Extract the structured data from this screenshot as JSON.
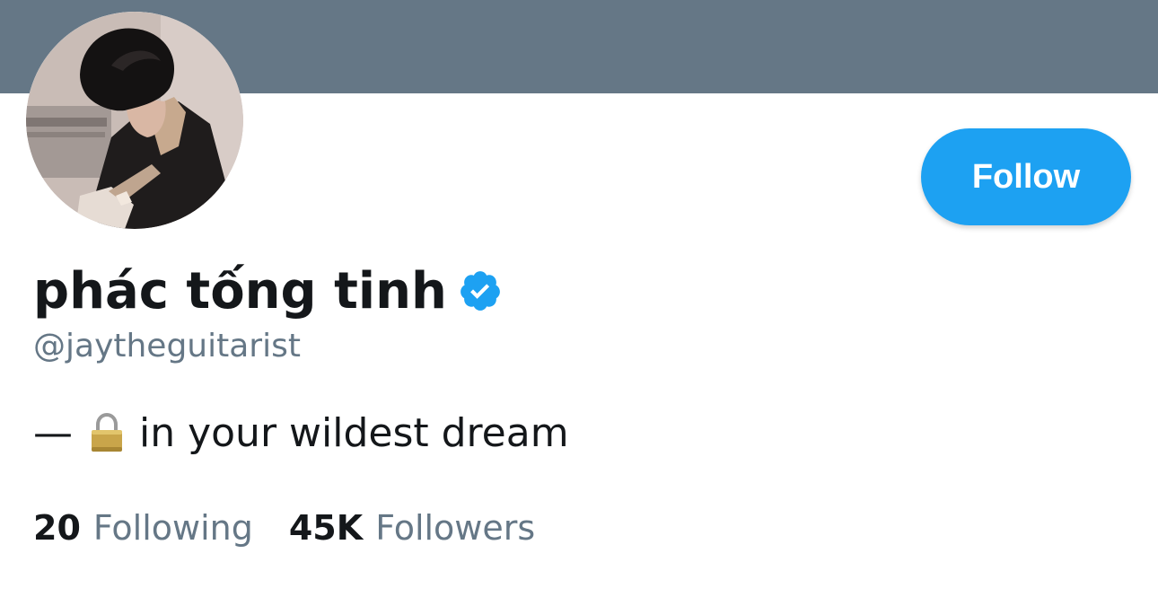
{
  "profile": {
    "display_name": "phác tống tinh",
    "handle": "@jaytheguitarist",
    "verified": true,
    "bio_dash": "—",
    "bio_icon": "lock-icon",
    "bio_text": "in your wildest dream"
  },
  "actions": {
    "follow_label": "Follow"
  },
  "stats": {
    "following_count": "20",
    "following_label": "Following",
    "followers_count": "45K",
    "followers_label": "Followers"
  },
  "colors": {
    "banner": "#657786",
    "accent": "#1da1f2",
    "text_primary": "#14171a",
    "text_secondary": "#657786"
  }
}
